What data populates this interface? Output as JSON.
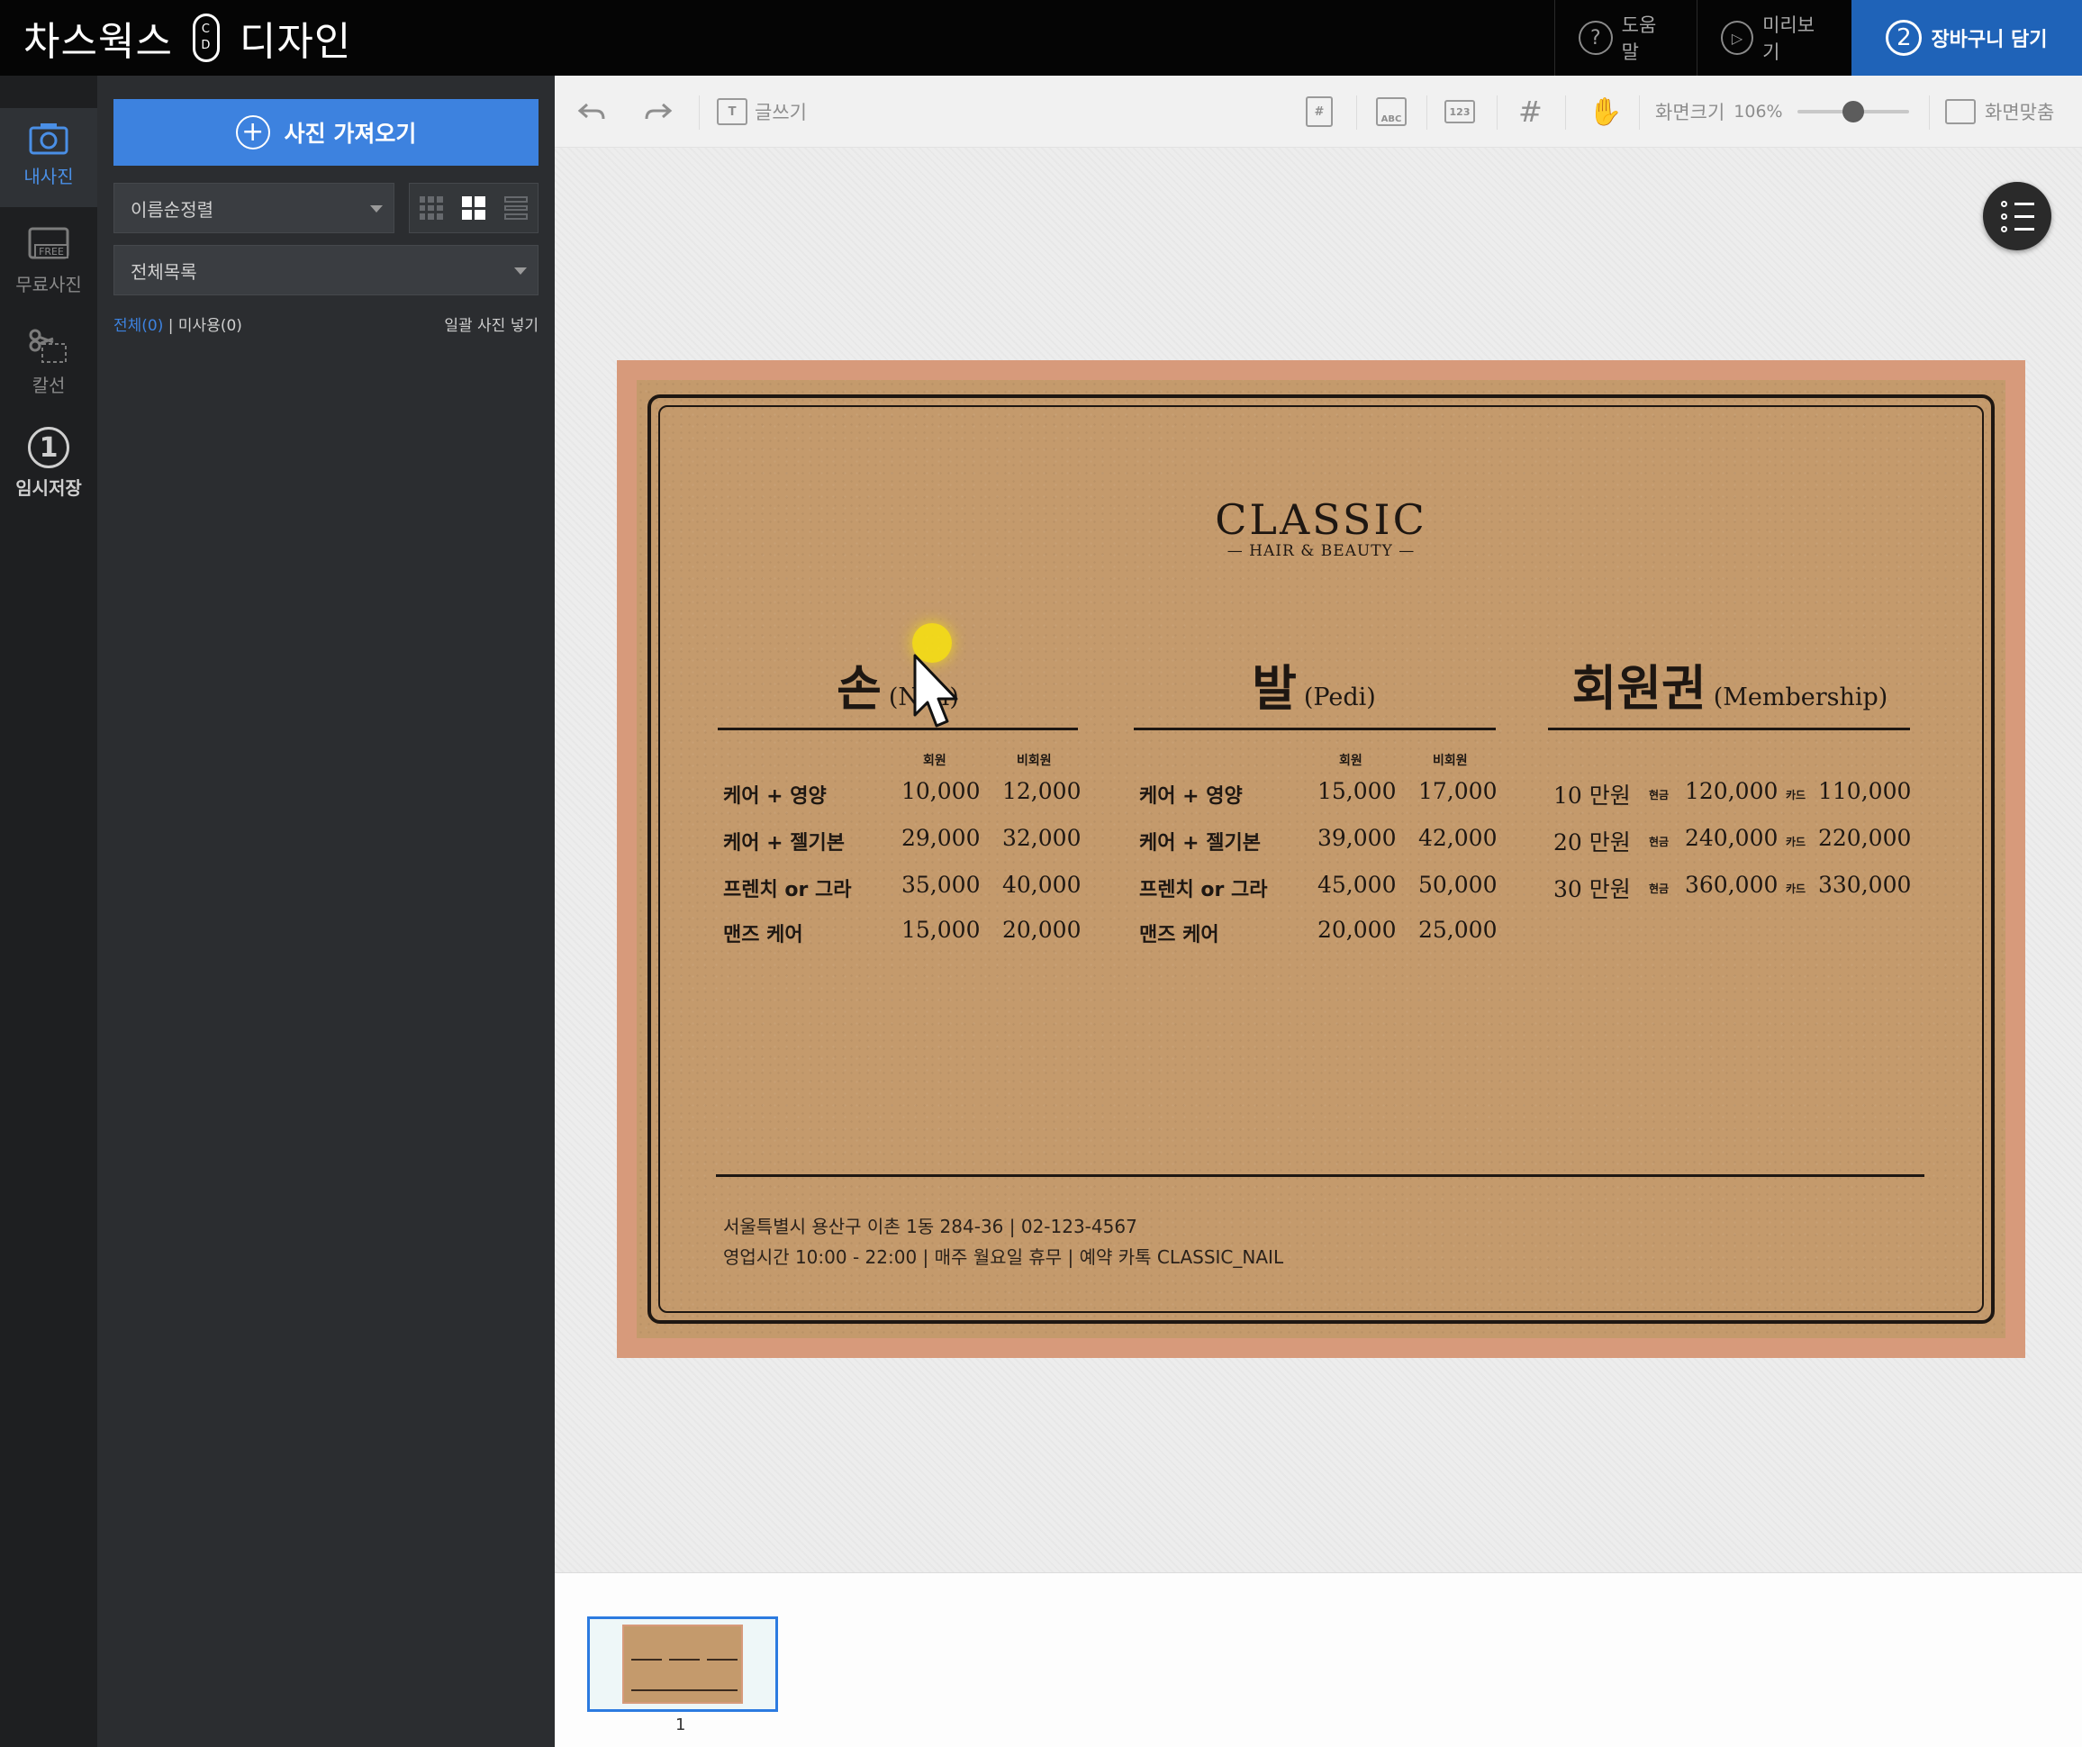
{
  "brand": {
    "left": "차스웍스",
    "logo_top": "C",
    "logo_bottom": "D",
    "right": "디자인"
  },
  "top_actions": {
    "help": "도움말",
    "preview": "미리보기",
    "cart_step": "2",
    "cart": "장바구니 담기"
  },
  "rail": {
    "my_photos": "내사진",
    "free_photos": "무료사진",
    "free_badge": "FREE",
    "cut": "칼선",
    "temp_save_num": "1",
    "temp_save": "임시저장"
  },
  "panel": {
    "import_button": "사진 가져오기",
    "sort_select": "이름순정렬",
    "list_select": "전체목록",
    "filter_all": "전체(0)",
    "filter_sep": "|",
    "filter_unused": "미사용(0)",
    "bulk_insert": "일괄 사진 넣기"
  },
  "toolbar": {
    "text_tool": "글쓰기",
    "zoom_label": "화면크기",
    "zoom_value": "106%",
    "fit": "화면맞춤",
    "abc": "ABC",
    "num": "123",
    "zoom_fraction": 0.5
  },
  "card": {
    "title": "CLASSIC",
    "subtitle": "— HAIR & BEAUTY —",
    "sections": [
      {
        "title": "손",
        "sub": "(Nail)"
      },
      {
        "title": "발",
        "sub": "(Pedi)"
      },
      {
        "title": "회원권",
        "sub": "(Membership)"
      }
    ],
    "col_member": "회원",
    "col_nonmember": "비회원",
    "nail_rows": [
      [
        "케어 + 영양",
        "10,000",
        "12,000"
      ],
      [
        "케어 + 젤기본",
        "29,000",
        "32,000"
      ],
      [
        "프렌치 or 그라",
        "35,000",
        "40,000"
      ],
      [
        "맨즈 케어",
        "15,000",
        "20,000"
      ]
    ],
    "pedi_rows": [
      [
        "케어 + 영양",
        "15,000",
        "17,000"
      ],
      [
        "케어 + 젤기본",
        "39,000",
        "42,000"
      ],
      [
        "프렌치 or 그라",
        "45,000",
        "50,000"
      ],
      [
        "맨즈 케어",
        "20,000",
        "25,000"
      ]
    ],
    "cash_label": "현금",
    "card_label": "카드",
    "membership_rows": [
      [
        "10 만원",
        "120,000",
        "110,000"
      ],
      [
        "20 만원",
        "240,000",
        "220,000"
      ],
      [
        "30 만원",
        "360,000",
        "330,000"
      ]
    ],
    "footer_line1": "서울특별시 용산구 이촌 1동 284-36  |  02-123-4567",
    "footer_line2": "영업시간 10:00 - 22:00  |  매주 월요일 휴무  |  예약 카톡 CLASSIC_NAIL"
  },
  "pages": {
    "current": "1"
  },
  "colors": {
    "accent": "#3d82df",
    "cart_bg": "#1f63b8",
    "card_border": "#d79a7b",
    "kraft": "#c49a6c",
    "topbar": "#050505"
  }
}
